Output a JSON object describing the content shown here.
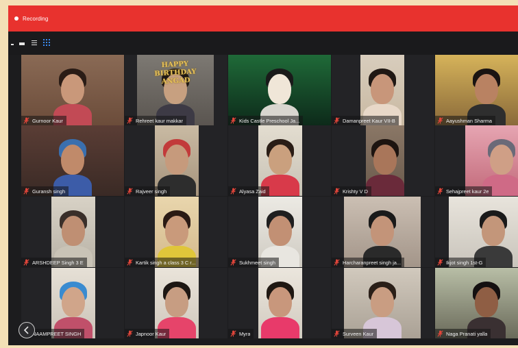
{
  "recording": {
    "label": "Recording"
  },
  "participants": [
    {
      "name": "Gurnoor Kaur",
      "muted": true
    },
    {
      "name": "Rehreet kaur makkar",
      "muted": true,
      "banner": "HAPPY BIRTHDAY ANGAD"
    },
    {
      "name": "Kids Castle Preschool Ja...",
      "muted": true
    },
    {
      "name": "Damanpreet Kaur VII-B",
      "muted": true
    },
    {
      "name": "Aayushman Sharma",
      "muted": true
    },
    {
      "name": "Guransh singh",
      "muted": true
    },
    {
      "name": "Rajveer singh",
      "muted": true
    },
    {
      "name": "Alyasa Zaid",
      "muted": true
    },
    {
      "name": "Krishty V D",
      "muted": true
    },
    {
      "name": "Sehajpreet kaur 2e",
      "muted": true
    },
    {
      "name": "ARSHDEEP Singh 3 E",
      "muted": true
    },
    {
      "name": "Kartik singh a class 3 C r...",
      "muted": true
    },
    {
      "name": "Sukhmeet singh",
      "muted": true
    },
    {
      "name": "Harcharanpreet singh ja...",
      "muted": true
    },
    {
      "name": "Ikjot singh 1st-G",
      "muted": true
    },
    {
      "name": "NAAMPREET SINGH",
      "muted": true
    },
    {
      "name": "Japnoor Kaur",
      "muted": true
    },
    {
      "name": "Myra",
      "muted": true
    },
    {
      "name": "Surveen Kaur",
      "muted": true
    },
    {
      "name": "Naga Pranati yalla",
      "muted": true
    }
  ],
  "colors": {
    "recording_bar": "#e8322e",
    "active_view": "#3b8bf5",
    "mute_icon": "#e0453a"
  }
}
